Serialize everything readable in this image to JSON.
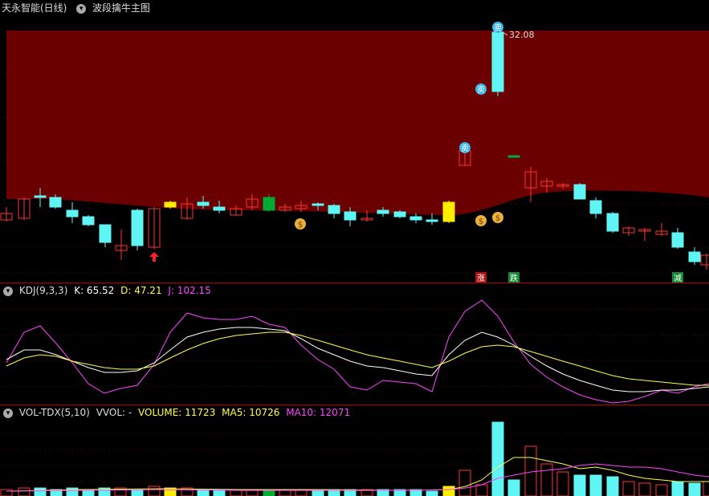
{
  "header": {
    "stock_title": "天永智能(日线)",
    "indicator_icon": "chevron-down-icon",
    "indicator_name": "波段擒牛主图"
  },
  "main_chart": {
    "high_label": "32.08",
    "markers": {
      "sell": "卖",
      "money": "$",
      "up": "涨",
      "down": "跌",
      "reduce": "减"
    },
    "colors": {
      "band": "#6b0000",
      "up": "#ff3333",
      "down": "#5ff5f5",
      "yellow": "#ffee00",
      "green": "#00aa33"
    }
  },
  "kdj": {
    "name": "KDJ(9,3,3)",
    "k_label": "K: 65.52",
    "d_label": "D: 47.21",
    "j_label": "J: 102.15",
    "colors": {
      "k": "#ffffff",
      "d": "#ffff44",
      "j": "#ff44ff"
    }
  },
  "vol": {
    "name": "VOL-TDX(5,10)",
    "vvol_label": "VVOL: -",
    "volume_label": "VOLUME: 11723",
    "ma5_label": "MA5: 10726",
    "ma10_label": "MA10: 12071",
    "colors": {
      "ma5": "#ffff44",
      "ma10": "#ff44ff"
    }
  }
}
